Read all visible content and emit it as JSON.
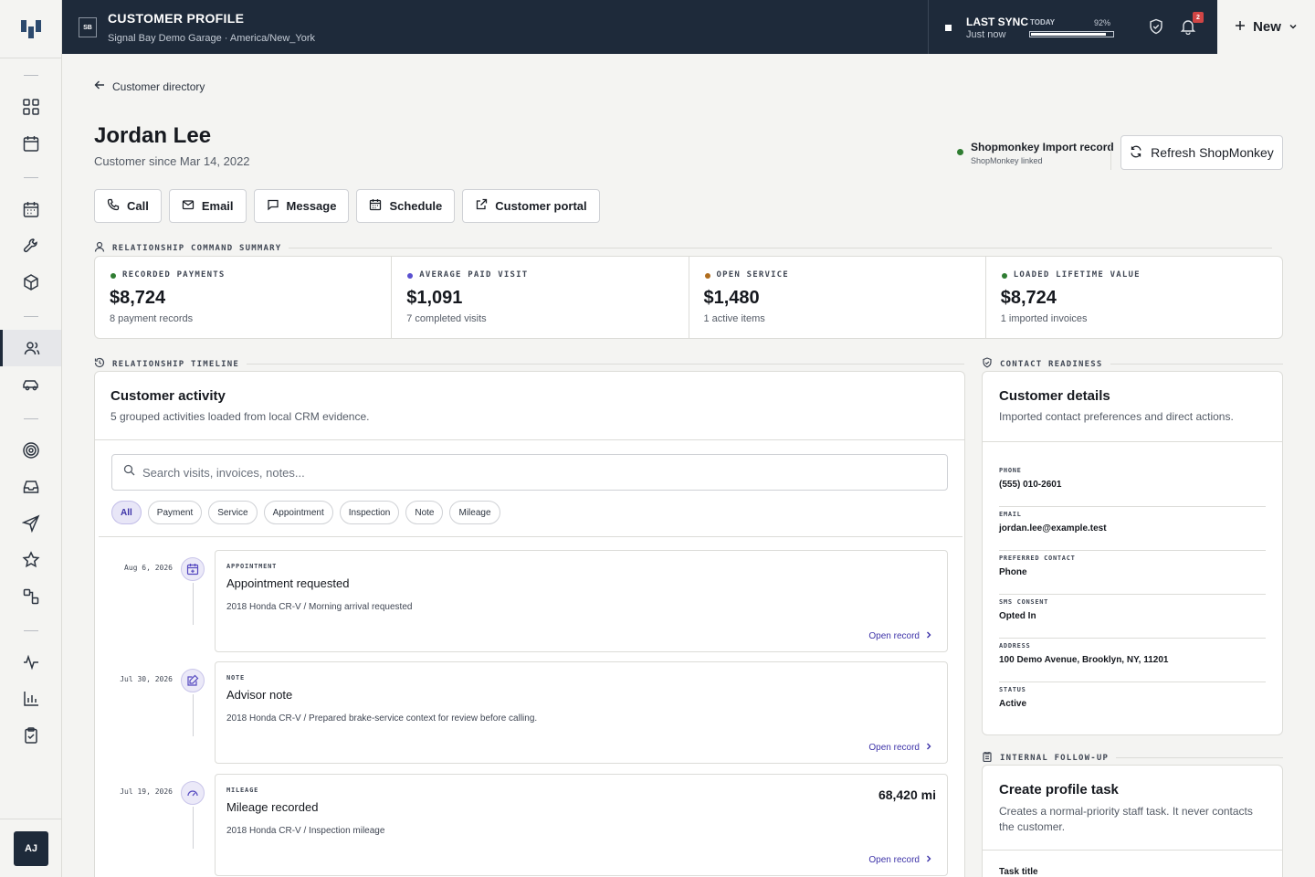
{
  "topbar": {
    "badge": "SB",
    "title": "CUSTOMER PROFILE",
    "subtitle": "Signal Bay Demo Garage · America/New_York",
    "sync_title": "LAST SYNC",
    "sync_sub": "Just now",
    "today_label": "TODAY",
    "progress_label": "92%",
    "progress_value": 0.92,
    "notification_count": "2",
    "new_label": "New"
  },
  "sidebar": {
    "icons": [
      "dashboard-icon",
      "calendar-icon",
      "schedule-icon",
      "wrench-icon",
      "box-icon",
      "customers-icon",
      "vehicle-icon",
      "target-icon",
      "inbox-icon",
      "send-icon",
      "star-icon",
      "workflow-icon",
      "activity-icon",
      "chart-icon",
      "clipboard-icon"
    ],
    "active": "customers-icon",
    "avatar": "AJ"
  },
  "page": {
    "breadcrumb": "Customer directory",
    "name": "Jordan Lee",
    "since": "Customer since Mar 14, 2022",
    "sm_record_title": "Shopmonkey Import record",
    "sm_record_sub": "ShopMonkey linked",
    "refresh_label": "Refresh ShopMonkey",
    "actions": [
      "Call",
      "Email",
      "Message",
      "Schedule",
      "Customer portal"
    ]
  },
  "summary": {
    "section_label": "RELATIONSHIP COMMAND SUMMARY",
    "metrics": [
      {
        "label": "RECORDED PAYMENTS",
        "value": "$8,724",
        "sub": "8 payment records",
        "color": "#2f7d32"
      },
      {
        "label": "AVERAGE PAID VISIT",
        "value": "$1,091",
        "sub": "7 completed visits",
        "color": "#5a50d0"
      },
      {
        "label": "OPEN SERVICE",
        "value": "$1,480",
        "sub": "1 active items",
        "color": "#b06d1e"
      },
      {
        "label": "LOADED LIFETIME VALUE",
        "value": "$8,724",
        "sub": "1 imported invoices",
        "color": "#2f7d32"
      }
    ]
  },
  "timeline": {
    "section_label": "RELATIONSHIP TIMELINE",
    "title": "Customer activity",
    "subtitle": "5 grouped activities loaded from local CRM evidence.",
    "search_placeholder": "Search visits, invoices, notes...",
    "filters": [
      "All",
      "Payment",
      "Service",
      "Appointment",
      "Inspection",
      "Note",
      "Mileage"
    ],
    "active_filter": "All",
    "open_label": "Open record",
    "items": [
      {
        "date": "Aug 6, 2026",
        "kind": "APPOINTMENT",
        "title": "Appointment requested",
        "desc": "2018 Honda CR-V / Morning arrival requested",
        "metric": "",
        "icon": "calendar-plus-icon"
      },
      {
        "date": "Jul 30, 2026",
        "kind": "NOTE",
        "title": "Advisor note",
        "desc": "2018 Honda CR-V / Prepared brake-service context for review before calling.",
        "metric": "",
        "icon": "note-edit-icon"
      },
      {
        "date": "Jul 19, 2026",
        "kind": "MILEAGE",
        "title": "Mileage recorded",
        "desc": "2018 Honda CR-V / Inspection mileage",
        "metric": "68,420 mi",
        "icon": "gauge-icon"
      }
    ]
  },
  "contact": {
    "section_label": "CONTACT READINESS",
    "title": "Customer details",
    "subtitle": "Imported contact preferences and direct actions.",
    "fields": [
      {
        "label": "PHONE",
        "value": "(555) 010-2601"
      },
      {
        "label": "EMAIL",
        "value": "jordan.lee@example.test"
      },
      {
        "label": "PREFERRED CONTACT",
        "value": "Phone"
      },
      {
        "label": "SMS CONSENT",
        "value": "Opted In"
      },
      {
        "label": "ADDRESS",
        "value": "100 Demo Avenue, Brooklyn, NY, 11201"
      },
      {
        "label": "STATUS",
        "value": "Active"
      }
    ]
  },
  "followup": {
    "section_label": "INTERNAL FOLLOW-UP",
    "title": "Create profile task",
    "subtitle": "Creates a normal-priority staff task. It never contacts the customer.",
    "task_title_label": "Task title"
  }
}
